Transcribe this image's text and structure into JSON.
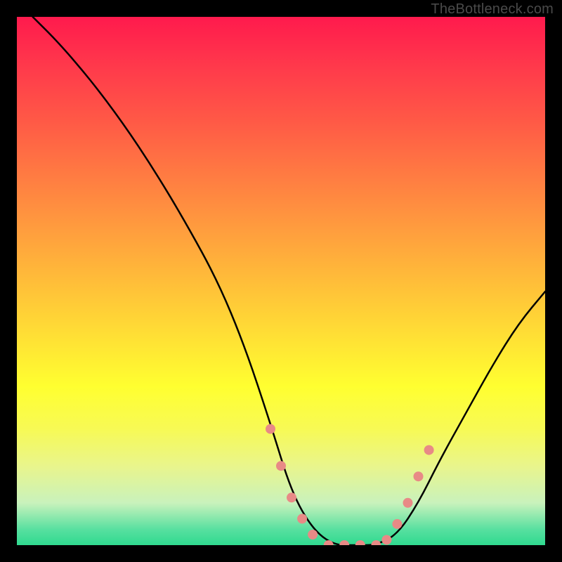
{
  "watermark": {
    "text": "TheBottleneck.com"
  },
  "chart_data": {
    "type": "line",
    "title": "",
    "xlabel": "",
    "ylabel": "",
    "xlim": [
      0,
      100
    ],
    "ylim": [
      0,
      100
    ],
    "gradient_bands": [
      {
        "name": "red",
        "range_pct": [
          0,
          20
        ]
      },
      {
        "name": "orange",
        "range_pct": [
          20,
          50
        ]
      },
      {
        "name": "yellow",
        "range_pct": [
          50,
          85
        ]
      },
      {
        "name": "green",
        "range_pct": [
          85,
          100
        ]
      }
    ],
    "series": [
      {
        "name": "bottleneck-curve",
        "x": [
          3,
          8,
          14,
          20,
          26,
          32,
          38,
          43,
          48,
          52,
          56,
          60,
          64,
          68,
          72,
          76,
          80,
          85,
          90,
          95,
          100
        ],
        "y": [
          100,
          95,
          88,
          80,
          71,
          61,
          50,
          38,
          23,
          10,
          3,
          0,
          0,
          0,
          2,
          8,
          16,
          25,
          34,
          42,
          48
        ]
      }
    ],
    "flat_valley_x_range": [
      56,
      70
    ],
    "markers": {
      "name": "valley-markers",
      "color": "#e88a86",
      "points_x": [
        48,
        50,
        52,
        54,
        56,
        59,
        62,
        65,
        68,
        70,
        72,
        74,
        76,
        78
      ],
      "points_y": [
        22,
        15,
        9,
        5,
        2,
        0,
        0,
        0,
        0,
        1,
        4,
        8,
        13,
        18
      ]
    }
  }
}
